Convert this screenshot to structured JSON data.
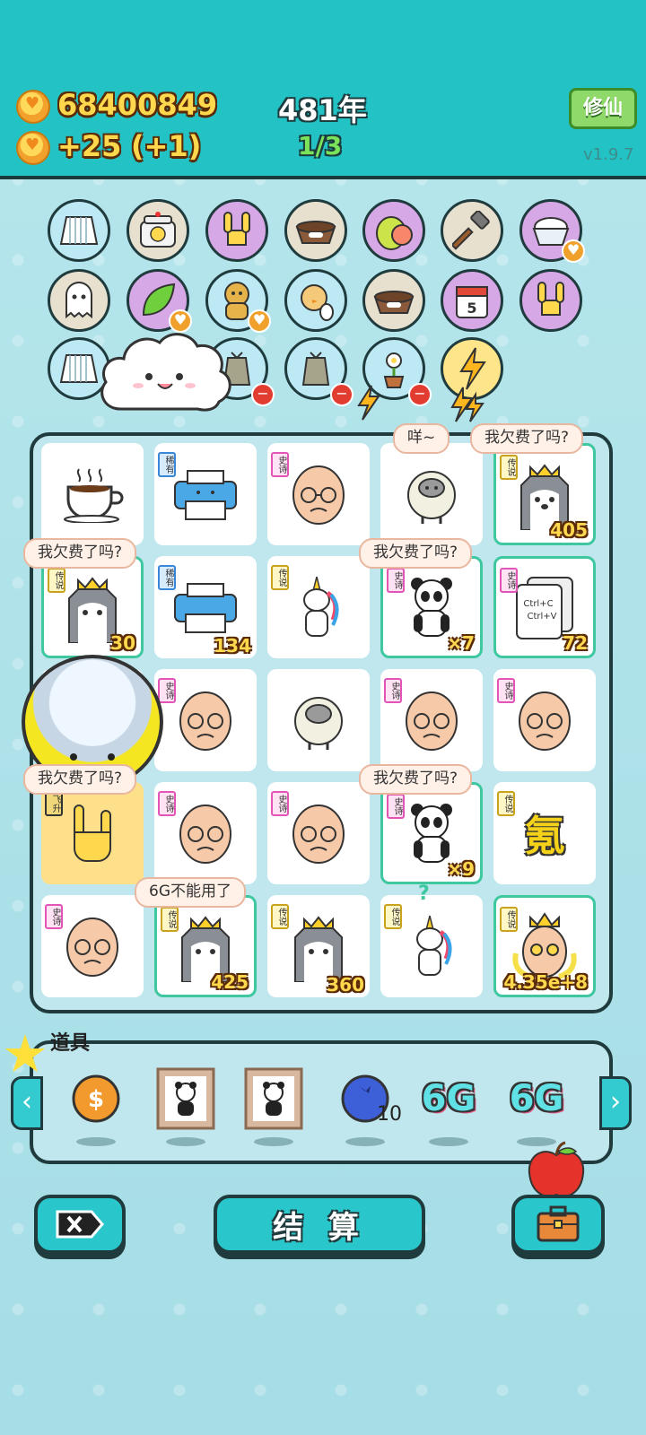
{
  "header": {
    "coins": "68400849",
    "income": "+25",
    "income_bonus": "(+1)",
    "year": "481年",
    "progress": "1/3",
    "xiuxian_label": "修仙",
    "version": "v1.9.7"
  },
  "items_row1": [
    "skirt-icon",
    "duck-pot-icon",
    "rock-hand-icon",
    "dog-bowl-icon",
    "guava-icon",
    "hammer-icon",
    "rice-bowl-icon"
  ],
  "items_row2": [
    "ghost-icon",
    "leaf-icon",
    "bear-icon",
    "chick-icon",
    "dog-bowl-icon",
    "calendar-icon",
    "rock-hand-icon"
  ],
  "calendar_day": "5",
  "items_row3": [
    "skirt-icon",
    "trash-bag-icon",
    "trash-bag-icon",
    "flower-pot-icon",
    "lightning-icon"
  ],
  "board": {
    "bubbles": {
      "b1": "咩~",
      "b2": "我欠费了吗?",
      "b3": "我欠费了吗?",
      "b4": "我欠费了吗?",
      "b5": "我欠费了吗?",
      "b6": "我欠费了吗?",
      "b7": "6G不能用了"
    },
    "cards": [
      {
        "icon": "coffee-icon",
        "tag": "",
        "count": ""
      },
      {
        "icon": "printer-icon",
        "tag": "稀有",
        "count": ""
      },
      {
        "icon": "old-man-icon",
        "tag": "史诗",
        "count": ""
      },
      {
        "icon": "sheep-icon",
        "tag": "",
        "count": ""
      },
      {
        "icon": "husky-icon",
        "tag": "传说",
        "count": "405"
      },
      {
        "icon": "husky-icon",
        "tag": "传说",
        "count": "30"
      },
      {
        "icon": "printer-icon",
        "tag": "稀有",
        "count": "134"
      },
      {
        "icon": "unicorn-icon",
        "tag": "传说",
        "count": ""
      },
      {
        "icon": "panda-icon",
        "tag": "史诗",
        "count": "×7"
      },
      {
        "icon": "copy-paste-icon",
        "tag": "史诗",
        "count": "72"
      },
      {
        "icon": "old-man-icon",
        "tag": "史诗",
        "count": ""
      },
      {
        "icon": "old-man-icon",
        "tag": "史诗",
        "count": ""
      },
      {
        "icon": "sheep-icon",
        "tag": "",
        "count": ""
      },
      {
        "icon": "old-man-icon",
        "tag": "史诗",
        "count": ""
      },
      {
        "icon": "old-man-icon",
        "tag": "史诗",
        "count": ""
      },
      {
        "icon": "rock-hand-icon",
        "tag": "飞升",
        "count": ""
      },
      {
        "icon": "old-man-icon",
        "tag": "史诗",
        "count": ""
      },
      {
        "icon": "old-man-icon",
        "tag": "史诗",
        "count": ""
      },
      {
        "icon": "panda-icon",
        "tag": "史诗",
        "count": "×9"
      },
      {
        "icon": "chem-element-icon",
        "tag": "传说",
        "count": ""
      },
      {
        "icon": "old-man-icon",
        "tag": "史诗",
        "count": ""
      },
      {
        "icon": "husky-icon",
        "tag": "传说",
        "count": "425"
      },
      {
        "icon": "husky-icon",
        "tag": "传说",
        "count": "360"
      },
      {
        "icon": "unicorn-icon",
        "tag": "传说",
        "count": ""
      },
      {
        "icon": "king-old-man-icon",
        "tag": "传说",
        "count": "4.35e+8"
      }
    ],
    "chem_char": "氪",
    "copy_paste_text1": "Ctrl+C",
    "copy_paste_text2": "Ctrl+V",
    "question_mark": "?"
  },
  "props": {
    "label": "道具",
    "items": [
      {
        "icon": "coin-icon",
        "count": ""
      },
      {
        "icon": "panda-frame-icon",
        "count": ""
      },
      {
        "icon": "panda-frame-icon",
        "count": ""
      },
      {
        "icon": "blueberry-icon",
        "count": "10"
      },
      {
        "icon": "6g-icon",
        "count": ""
      },
      {
        "icon": "6g-icon",
        "count": ""
      }
    ],
    "six_g_text": "6G"
  },
  "buttons": {
    "settle_label": "结 算"
  },
  "colors": {
    "header_bg": "#23c3c5",
    "page_bg": "#a9dfe6",
    "accent_gold": "#ffd84d",
    "border_dark": "#1f3b3d"
  }
}
